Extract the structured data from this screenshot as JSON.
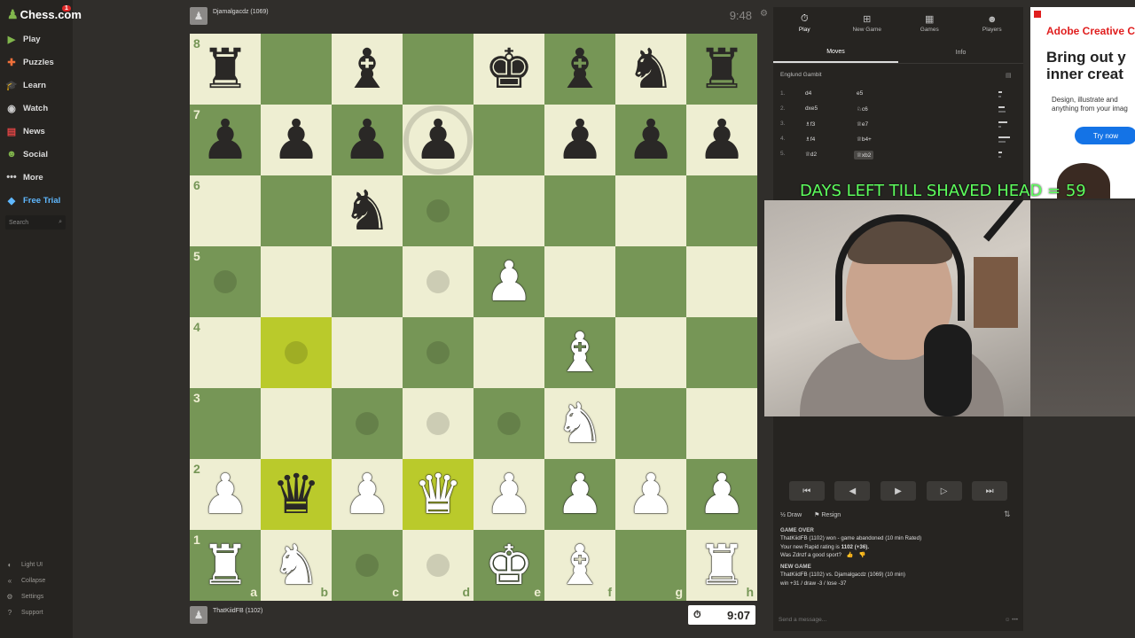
{
  "sidebar": {
    "logo": "Chess.com",
    "notif_count": "1",
    "items": [
      {
        "label": "Play",
        "icon": "play-icon",
        "color": "#81b64c"
      },
      {
        "label": "Puzzles",
        "icon": "puzzle-icon",
        "color": "#f0703a"
      },
      {
        "label": "Learn",
        "icon": "learn-icon",
        "color": "#4fa1e6"
      },
      {
        "label": "Watch",
        "icon": "watch-icon",
        "color": "#ccc"
      },
      {
        "label": "News",
        "icon": "news-icon",
        "color": "#e04444"
      },
      {
        "label": "Social",
        "icon": "social-icon",
        "color": "#81b64c"
      },
      {
        "label": "More",
        "icon": "more-icon",
        "color": "#ccc"
      },
      {
        "label": "Free Trial",
        "icon": "diamond-icon",
        "color": "#5fb8ff"
      }
    ],
    "search_placeholder": "Search",
    "bottom": [
      {
        "label": "Light UI",
        "icon": "light-ui-icon"
      },
      {
        "label": "Collapse",
        "icon": "collapse-icon"
      },
      {
        "label": "Settings",
        "icon": "settings-icon"
      },
      {
        "label": "Support",
        "icon": "support-icon"
      }
    ]
  },
  "game": {
    "top_player": "Djamalgacdz (1069)",
    "top_clock": "9:48",
    "bottom_player": "ThatKiidFB (1102)",
    "bottom_clock": "9:07",
    "files": [
      "a",
      "b",
      "c",
      "d",
      "e",
      "f",
      "g",
      "h"
    ],
    "ranks": [
      "8",
      "7",
      "6",
      "5",
      "4",
      "3",
      "2",
      "1"
    ],
    "board": [
      [
        "br",
        "",
        "bb",
        "",
        "bk",
        "bb",
        "bn",
        "br"
      ],
      [
        "bp",
        "bp",
        "bp",
        "bp",
        "",
        "bp",
        "bp",
        "bp"
      ],
      [
        "",
        "",
        "bn",
        "",
        "",
        "",
        "",
        ""
      ],
      [
        "",
        "",
        "",
        "",
        "wp",
        "",
        "",
        ""
      ],
      [
        "",
        "",
        "",
        "",
        "",
        "wb",
        "",
        ""
      ],
      [
        "",
        "",
        "",
        "",
        "",
        "wn",
        "",
        ""
      ],
      [
        "wp",
        "bq",
        "wp",
        "wq",
        "wp",
        "wp",
        "wp",
        "wp"
      ],
      [
        "wr",
        "wn",
        "",
        "",
        "wk",
        "wb",
        "",
        "wr"
      ]
    ],
    "highlights": [
      "b4",
      "b2",
      "d2"
    ],
    "dots": [
      "d6",
      "a5",
      "d5",
      "b4",
      "d4",
      "c3",
      "d3",
      "e3",
      "c1",
      "d1"
    ],
    "rings": [
      "d7"
    ]
  },
  "panel": {
    "tabs": [
      {
        "label": "Play",
        "icon": "clock-icon"
      },
      {
        "label": "New Game",
        "icon": "plus-icon"
      },
      {
        "label": "Games",
        "icon": "games-icon"
      },
      {
        "label": "Players",
        "icon": "players-icon"
      }
    ],
    "sub_tabs": [
      "Moves",
      "Info"
    ],
    "opening": "Englund Gambit",
    "moves": [
      {
        "num": "1.",
        "white": "d4",
        "black": "e5"
      },
      {
        "num": "2.",
        "white": "dxe5",
        "black": "♘c6"
      },
      {
        "num": "3.",
        "white": "♗f3",
        "black": "♕e7"
      },
      {
        "num": "4.",
        "white": "♗f4",
        "black": "♕b4+"
      },
      {
        "num": "5.",
        "white": "♕d2",
        "black": "♕xb2"
      }
    ],
    "actions": {
      "draw": "Draw",
      "resign": "Resign"
    },
    "chat": {
      "game_over_header": "GAME OVER",
      "game_over_line": "ThatKiidFB (1102) won - game abandoned (10 min Rated)",
      "rating_line_prefix": "Your new Rapid rating is ",
      "rating_value": "1102 (+36).",
      "sport_question": "Was Zdnzf a good sport?",
      "new_game_header": "NEW GAME",
      "new_game_line": "ThatKiidFB (1102) vs. Djamalgacdz (1069) (10 min)",
      "stats_line": "win +31 / draw -3 / lose -37"
    },
    "chat_placeholder": "Send a message..."
  },
  "ad": {
    "brand": "Adobe Creative C",
    "headline_1": "Bring out y",
    "headline_2": "inner creat",
    "copy_1": "Design, illustrate and",
    "copy_2": "anything from your imag",
    "cta": "Try now"
  },
  "overlay": {
    "text": "DAYS LEFT TILL SHAVED HEAD = 59",
    "color": "#5dff5d"
  }
}
